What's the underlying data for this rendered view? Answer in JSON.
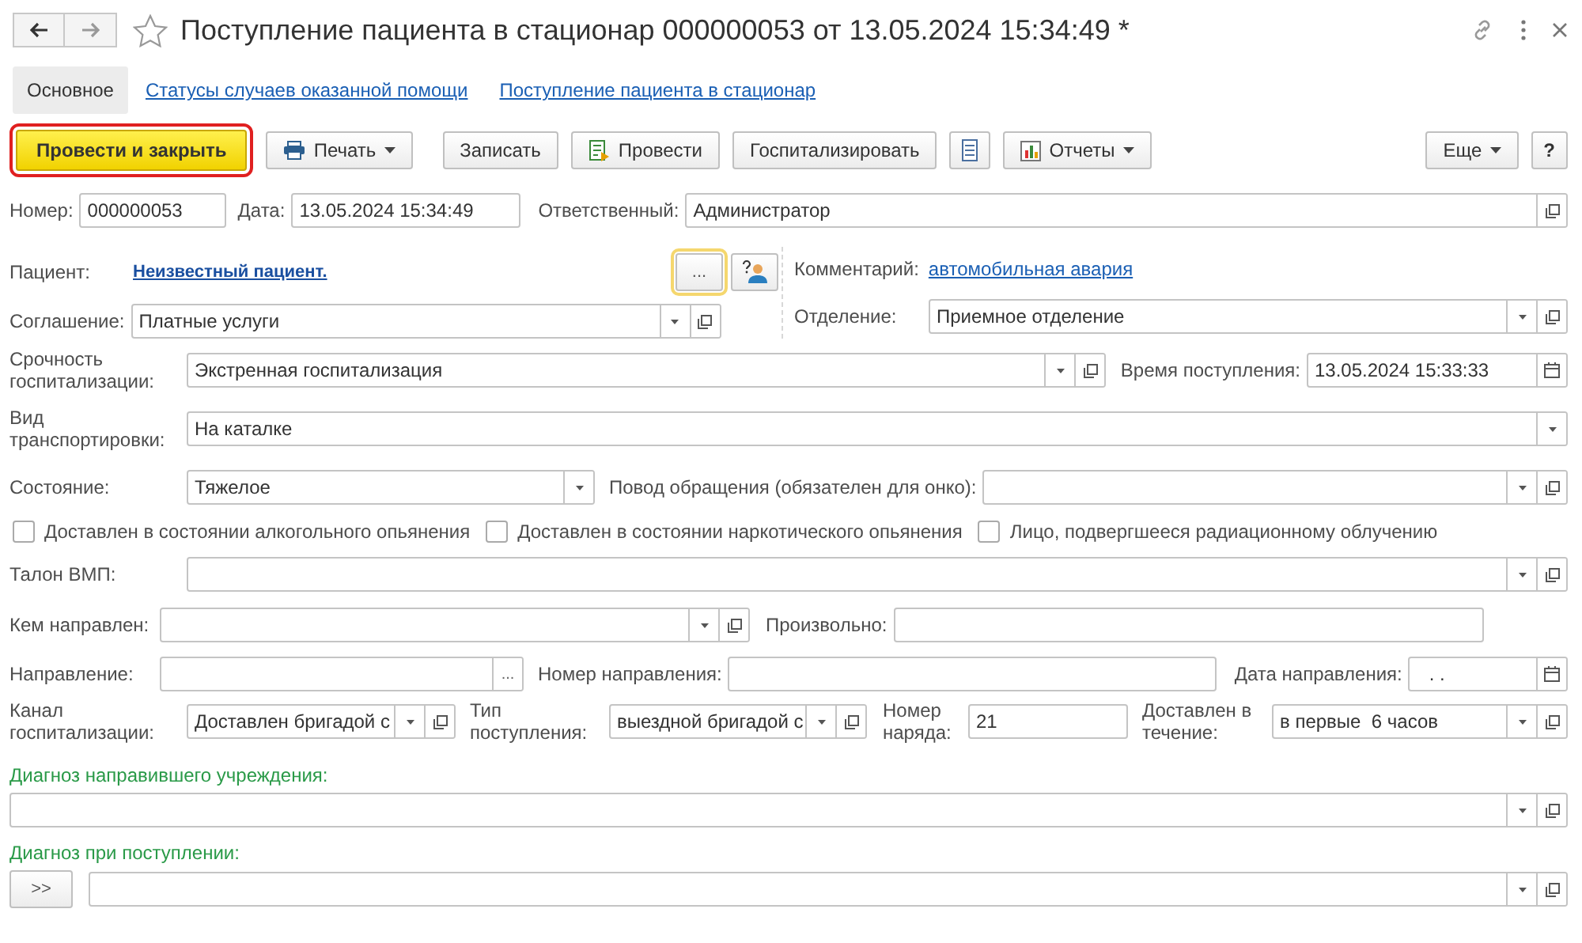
{
  "window": {
    "title": "Поступление пациента в стационар 000000053 от 13.05.2024 15:34:49 *",
    "favorite": false
  },
  "tabs": [
    {
      "label": "Основное",
      "selected": true
    },
    {
      "label": "Статусы случаев оказанной помощи",
      "selected": false
    },
    {
      "label": "Поступление пациента в стационар",
      "selected": false
    }
  ],
  "toolbar": [
    "Провести и закрыть",
    "Печать",
    "Записать",
    "Провести",
    "Госпитализировать",
    "Отчеты",
    "Еще",
    "?"
  ],
  "form": {
    "number": {
      "label": "Номер:",
      "value": "000000053"
    },
    "date": {
      "label": "Дата:",
      "value": "13.05.2024 15:34:49"
    },
    "responsible": {
      "label": "Ответственный:",
      "value": "Администратор"
    },
    "patient": {
      "label": "Пациент:",
      "value": "Неизвестный пациент.",
      "button": "..."
    },
    "comment": {
      "label": "Комментарий:",
      "value": "автомобильная авария"
    },
    "agreement": {
      "label": "Соглашение:",
      "value": "Платные услуги"
    },
    "department": {
      "label": "Отделение:",
      "value": "Приемное отделение"
    },
    "urgency": {
      "label": "Срочность госпитализации:",
      "value": "Экстренная госпитализация"
    },
    "arrival_time": {
      "label": "Время поступления:",
      "value": "13.05.2024 15:33:33"
    },
    "transport": {
      "label": "Вид транспортировки:",
      "value": "На каталке"
    },
    "condition": {
      "label": "Состояние:",
      "value": "Тяжелое"
    },
    "reason": {
      "label": "Повод обращения (обязателен для онко):"
    },
    "checkboxes": [
      {
        "label": "Доставлен в состоянии алкогольного опьянения",
        "checked": false
      },
      {
        "label": "Доставлен в состоянии наркотического опьянения",
        "checked": false
      },
      {
        "label": "Лицо, подвергшееся радиационному облучению",
        "checked": false
      }
    ],
    "vmp": {
      "label": "Талон ВМП:"
    },
    "referred_by": {
      "label": "Кем направлен:"
    },
    "arbitrary": {
      "label": "Произвольно:"
    },
    "referral": {
      "label": "Направление:",
      "button": "..."
    },
    "referral_number": {
      "label": "Номер направления:"
    },
    "referral_date": {
      "label": "Дата направления:",
      "value": ". ."
    },
    "channel": {
      "label": "Канал госпитализации:",
      "value": "Доставлен бригадой с"
    },
    "admission_type": {
      "label": "Тип поступления:",
      "value": "выездной бригадой с"
    },
    "order_number": {
      "label": "Номер наряда:",
      "value": "21"
    },
    "delivered_within": {
      "label": "Доставлен в течение:",
      "value": "в первые  6 часов"
    },
    "referring_diagnosis": {
      "label": "Диагноз направившего учреждения:"
    },
    "admission_diagnosis": {
      "label": "Диагноз при поступлении:",
      "button": ">>"
    }
  }
}
